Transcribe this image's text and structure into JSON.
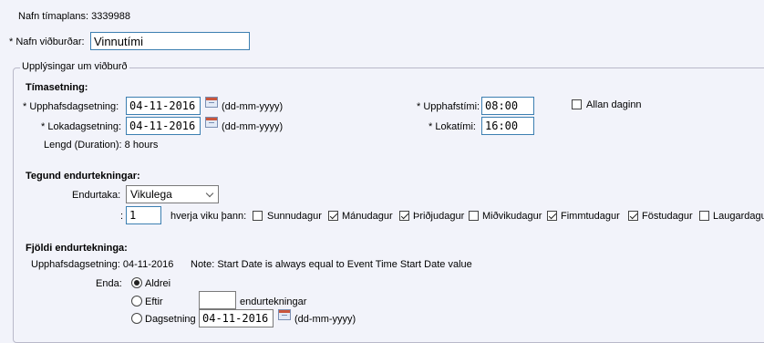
{
  "plan": {
    "label": "Nafn tímaplans:",
    "value": "3339988"
  },
  "event_name": {
    "label": "* Nafn viðburðar:",
    "value": "Vinnutími"
  },
  "fieldset_legend": "Upplýsingar um viðburð",
  "timing": {
    "heading": "Tímasetning:",
    "start_date_label": "* Upphafsdagsetning:",
    "start_date": "04-11-2016",
    "end_date_label": "* Lokadagsetning:",
    "end_date": "04-11-2016",
    "date_format": "(dd-mm-yyyy)",
    "duration": "Lengd (Duration): 8 hours",
    "start_time_label": "* Upphafstími:",
    "start_time": "08:00",
    "end_time_label": "* Lokatími:",
    "end_time": "16:00",
    "all_day_label": "Allan daginn",
    "all_day_checked": false
  },
  "recurrence": {
    "heading": "Tegund endurtekningar:",
    "repeat_label": "Endurtaka:",
    "repeat_value": "Vikulega",
    "interval_prefix": ":",
    "interval_value": "1",
    "interval_suffix": "hverja viku þann:",
    "days": [
      {
        "label": "Sunnudagur",
        "checked": false
      },
      {
        "label": "Mánudagur",
        "checked": true
      },
      {
        "label": "Þriðjudagur",
        "checked": true
      },
      {
        "label": "Miðvikudagur",
        "checked": false
      },
      {
        "label": "Fimmtudagur",
        "checked": true
      },
      {
        "label": "Föstudagur",
        "checked": true
      },
      {
        "label": "Laugardagur",
        "checked": false
      }
    ]
  },
  "occurrences": {
    "heading": "Fjöldi endurtekninga:",
    "start_line": "Upphafsdagsetning: 04-11-2016",
    "note": "Note: Start Date is always equal to Event Time Start Date value",
    "end_label": "Enda:",
    "opt_never": "Aldrei",
    "opt_after": "Eftir",
    "after_value": "",
    "after_suffix": "endurtekningar",
    "opt_date": "Dagsetning",
    "date_value": "04-11-2016",
    "date_format": "(dd-mm-yyyy)",
    "selected": "never"
  }
}
